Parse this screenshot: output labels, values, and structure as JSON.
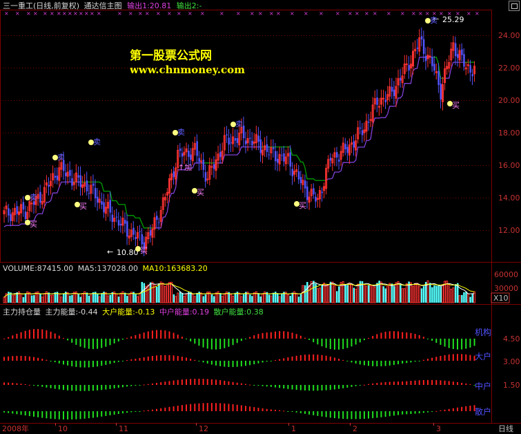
{
  "header": {
    "title": "三一重工(日线,前复权)",
    "indicator": "通达信主图",
    "out1": "输出1:20.81",
    "out2": "输出2:-"
  },
  "watermark": {
    "line1": "第一股票公式网",
    "line2": "www.chnmoney.com"
  },
  "price_axis": {
    "ticks": [
      "24.00",
      "22.00",
      "20.00",
      "18.00",
      "16.00",
      "14.00",
      "12.00"
    ]
  },
  "price_annotations": {
    "high": "25.29",
    "low": "10.80",
    "buy": "买",
    "sell": "卖",
    "add": "加"
  },
  "volume": {
    "vol": "VOLUME:87415.00",
    "ma5": "MA5:137028.00",
    "ma10": "MA10:163683.20",
    "ticks": [
      "60000",
      "30000"
    ],
    "unit": "X10"
  },
  "energy": {
    "name": "主力持仓量",
    "main": "主力能量:-0.44",
    "big": "大户能量:-0.13",
    "mid": "中户能量:0.19",
    "small": "散户能量:0.38",
    "ticks": [
      "4.50",
      "3.00",
      "1.50"
    ],
    "labels": [
      "机构",
      "大户",
      "中户",
      "散户"
    ]
  },
  "date_axis": {
    "labels": [
      "2008年",
      "10",
      "11",
      "12",
      "1",
      "2",
      "3"
    ],
    "period": "日线"
  },
  "colors": {
    "up": "#ff3232",
    "down": "#5454ff",
    "volume_down": "#54ffff",
    "ma_white": "#ffffff",
    "ma_yellow": "#ffff00",
    "trail_up": "#8040d8",
    "trail_down": "#00a000",
    "energy_pos": "#ff2020",
    "energy_neg": "#20e020",
    "grid": "#800000"
  }
}
